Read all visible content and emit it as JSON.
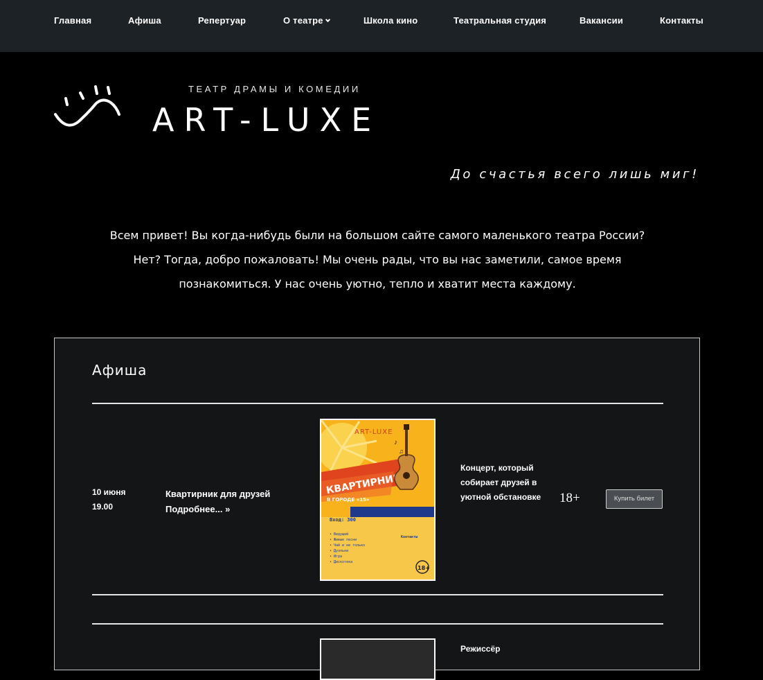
{
  "nav": {
    "items": [
      "Главная",
      "Афиша",
      "Репертуар",
      "О театре",
      "Школа кино",
      "Театральная студия",
      "Вакансии",
      "Контакты"
    ]
  },
  "logo": {
    "subtitle": "ТЕАТР ДРАМЫ И КОМЕДИИ",
    "name": "ART-LUXE"
  },
  "tagline": "До счастья всего лишь миг!",
  "intro": "Всем привет! Вы когда-нибудь были на большом сайте самого маленького театра России? Нет? Тогда, добро пожаловать! Мы очень рады, что вы нас заметили, самое время познакомиться. У нас очень уютно, тепло и хватит места каждому.",
  "afisha": {
    "heading": "Афиша",
    "events": [
      {
        "date": "10 июня",
        "time": "19.00",
        "title": "Квартирник для друзей",
        "more": "Подробнее...",
        "more_arrow": "»",
        "description": "Концерт, который собирает друзей в уютной обстановке",
        "age": "18+",
        "button": "Купить билет",
        "poster_name": "ART-LUXE",
        "poster_title": "КВАРТИРНИК",
        "poster_subtitle": "В ГОРОДЕ «15»"
      },
      {
        "description": "Режиссёр"
      }
    ]
  },
  "colors": {
    "background": "#000000",
    "nav_bg": "#1d2226",
    "panel_bg": "#131517",
    "poster_yellow": "#f7b21c",
    "poster_blue": "#1f3a8a"
  }
}
